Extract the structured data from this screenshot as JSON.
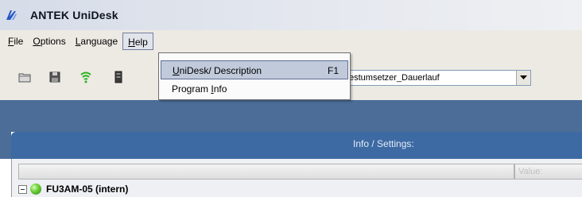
{
  "window": {
    "title": "ANTEK   UniDesk"
  },
  "menubar": {
    "items": [
      {
        "key": "F",
        "rest": "ile"
      },
      {
        "key": "O",
        "rest": "ptions"
      },
      {
        "key": "L",
        "rest": "anguage"
      },
      {
        "key": "H",
        "rest": "elp"
      }
    ]
  },
  "toolbar": {
    "icons": [
      "folder-open-icon",
      "save-icon",
      "wireless-signal-icon",
      "device-icon"
    ],
    "project_combo": {
      "value": "estumsetzer_Dauerlauf"
    }
  },
  "help_menu": {
    "items": [
      {
        "pre": "",
        "key": "U",
        "post": "niDesk/ Description",
        "shortcut": "F1"
      },
      {
        "pre": "Program ",
        "key": "I",
        "post": "nfo",
        "shortcut": ""
      }
    ]
  },
  "panel": {
    "title": "Info / Settings:",
    "column_value_label": "Value:",
    "tree": [
      {
        "label": "FU3AM-05 (intern)",
        "status": "online"
      }
    ]
  },
  "colors": {
    "accent_blue": "#4b6d97",
    "panel_blue": "#3d6aa3",
    "status_green": "#6fd13a"
  }
}
